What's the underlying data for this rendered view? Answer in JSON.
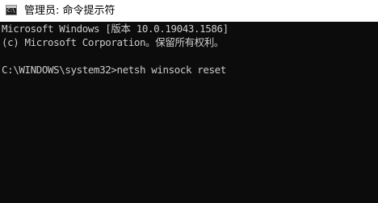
{
  "window": {
    "title": "管理员: 命令提示符",
    "icon": "cmd-icon",
    "icon_text": "C:\\"
  },
  "console": {
    "lines": [
      "Microsoft Windows [版本 10.0.19043.1586]",
      "(c) Microsoft Corporation。保留所有权利。",
      "",
      "C:\\WINDOWS\\system32>netsh winsock reset"
    ],
    "prompt": "C:\\WINDOWS\\system32>",
    "command": "netsh winsock reset"
  },
  "colors": {
    "background": "#0c0c0c",
    "foreground": "#cccccc",
    "titlebar": "#ffffff"
  }
}
